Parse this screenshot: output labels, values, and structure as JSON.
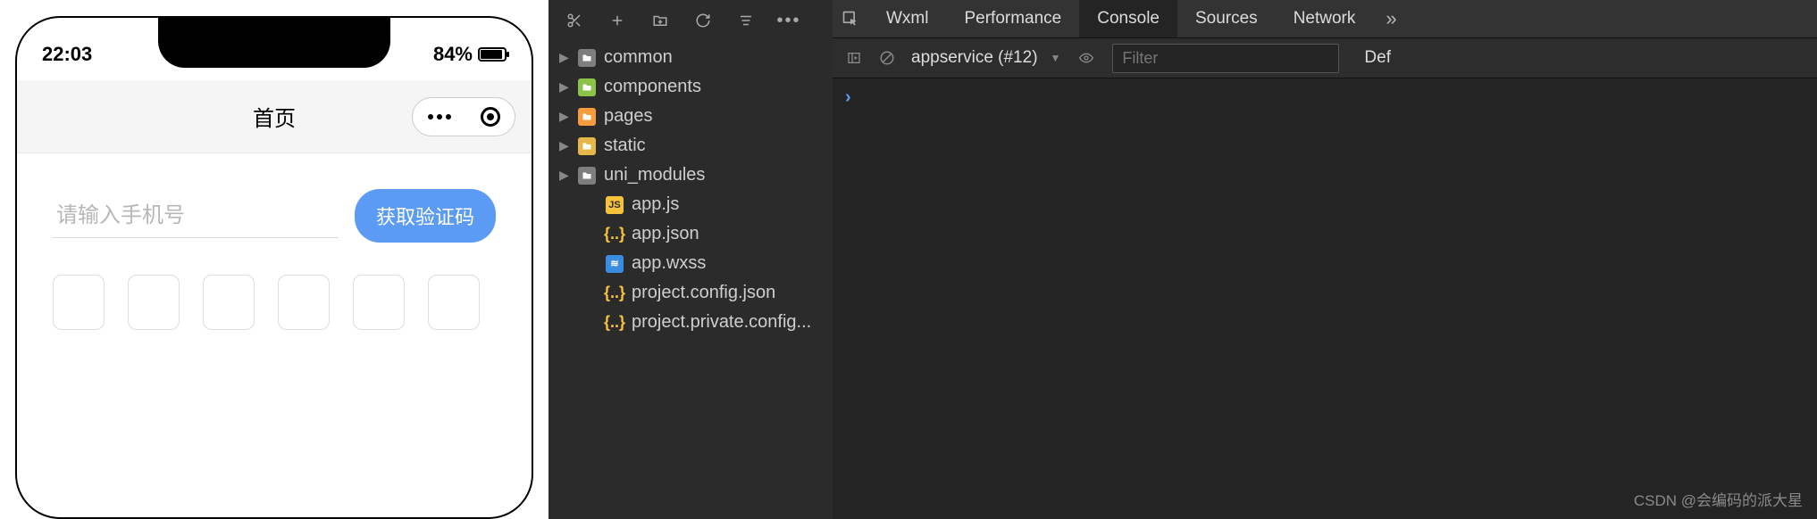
{
  "phone": {
    "status": {
      "time": "22:03",
      "battery": "84%"
    },
    "nav": {
      "title": "首页"
    },
    "form": {
      "phone_placeholder": "请输入手机号",
      "get_code_label": "获取验证码"
    }
  },
  "files_toolbar": {
    "icons": [
      "scissors",
      "plus",
      "new-folder",
      "refresh",
      "collapse",
      "more"
    ]
  },
  "files": [
    {
      "name": "common",
      "type": "folder",
      "color": "grey",
      "depth": 0,
      "expandable": true
    },
    {
      "name": "components",
      "type": "folder",
      "color": "green",
      "depth": 0,
      "expandable": true
    },
    {
      "name": "pages",
      "type": "folder",
      "color": "orange",
      "depth": 0,
      "expandable": true
    },
    {
      "name": "static",
      "type": "folder",
      "color": "yellow",
      "depth": 0,
      "expandable": true
    },
    {
      "name": "uni_modules",
      "type": "folder",
      "color": "grey",
      "depth": 0,
      "expandable": true
    },
    {
      "name": "app.js",
      "type": "file",
      "icon": "js",
      "depth": 1,
      "expandable": false
    },
    {
      "name": "app.json",
      "type": "file",
      "icon": "json",
      "depth": 1,
      "expandable": false
    },
    {
      "name": "app.wxss",
      "type": "file",
      "icon": "wxss",
      "depth": 1,
      "expandable": false
    },
    {
      "name": "project.config.json",
      "type": "file",
      "icon": "json",
      "depth": 1,
      "expandable": false
    },
    {
      "name": "project.private.config...",
      "type": "file",
      "icon": "json",
      "depth": 1,
      "expandable": false
    }
  ],
  "devtools": {
    "tabs": [
      "Wxml",
      "Performance",
      "Console",
      "Sources",
      "Network"
    ],
    "active_tab": "Console",
    "overflow": "»",
    "context": "appservice (#12)",
    "context_caret": "▼",
    "filter_placeholder": "Filter",
    "right_label": "Def",
    "prompt": "›"
  },
  "watermark": "CSDN @会编码的派大星"
}
